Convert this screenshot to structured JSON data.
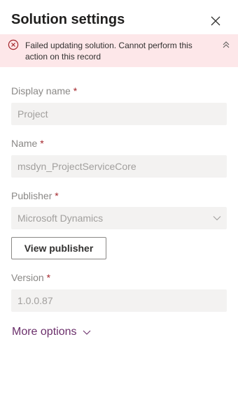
{
  "panel": {
    "title": "Solution settings"
  },
  "error": {
    "message": "Failed updating solution. Cannot perform this action on this record"
  },
  "fields": {
    "display_name": {
      "label": "Display name",
      "required": "*",
      "value": "Project"
    },
    "name": {
      "label": "Name",
      "required": "*",
      "value": "msdyn_ProjectServiceCore"
    },
    "publisher": {
      "label": "Publisher",
      "required": "*",
      "value": "Microsoft Dynamics"
    },
    "version": {
      "label": "Version",
      "required": "*",
      "value": "1.0.0.87"
    }
  },
  "buttons": {
    "view_publisher": "View publisher",
    "more_options": "More options"
  },
  "colors": {
    "error_background": "#fde7e9",
    "error_icon": "#a4262c",
    "required_marker": "#a4262c",
    "field_background": "#f3f2f1",
    "link": "#6b2f6b"
  },
  "icons": {
    "close": "close-icon",
    "error": "error-circle-icon",
    "collapse": "chevron-double-up-icon",
    "dropdown": "chevron-down-icon",
    "more": "chevron-down-icon"
  }
}
